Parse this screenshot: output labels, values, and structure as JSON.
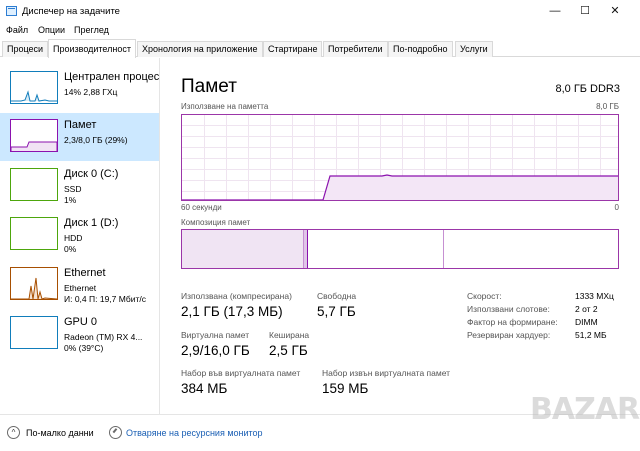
{
  "window": {
    "title": "Диспечер на задачите",
    "min_glyph": "—",
    "max_glyph": "☐",
    "close_glyph": "✕"
  },
  "menu": [
    "Файл",
    "Опции",
    "Преглед"
  ],
  "tabs": [
    {
      "label": "Процеси",
      "active": false
    },
    {
      "label": "Производителност",
      "active": true
    },
    {
      "label": "Хронология на приложение",
      "active": false
    },
    {
      "label": "Стартиране",
      "active": false
    },
    {
      "label": "Потребители",
      "active": false
    },
    {
      "label": "По-подробно",
      "active": false
    },
    {
      "label": "Услуги",
      "active": false
    }
  ],
  "sidebar": {
    "items": [
      {
        "name": "Централен процесор",
        "line1": "14%  2,88 ГХц",
        "line2": ""
      },
      {
        "name": "Памет",
        "line1": "2,3/8,0 ГБ (29%)",
        "line2": ""
      },
      {
        "name": "Диск 0 (C:)",
        "line1": "SSD",
        "line2": "1%"
      },
      {
        "name": "Диск 1 (D:)",
        "line1": "HDD",
        "line2": "0%"
      },
      {
        "name": "Ethernet",
        "line1": "Ethernet",
        "line2": "И: 0,4  П: 19,7 Мбит/с"
      },
      {
        "name": "GPU 0",
        "line1": "Radeon (TM) RX 4...",
        "line2": "0% (39°C)"
      }
    ]
  },
  "main": {
    "title": "Памет",
    "mem_type": "8,0 ГБ DDR3",
    "usage_label": "Използване на паметта",
    "usage_max": "8,0 ГБ",
    "time_left": "60 секунди",
    "time_right": "0",
    "composition_label": "Композиция памет",
    "stats": {
      "in_use_label": "Използвана (компресирана)",
      "in_use_value": "2,1 ГБ (17,3 МБ)",
      "available_label": "Свободна",
      "available_value": "5,7 ГБ",
      "committed_label": "Виртуална памет",
      "committed_value": "2,9/16,0 ГБ",
      "cached_label": "Кеширана",
      "cached_value": "2,5 ГБ",
      "paged_label": "Набор във виртуалната памет",
      "paged_value": "384 МБ",
      "nonpaged_label": "Набор извън виртуалната памет",
      "nonpaged_value": "159 МБ"
    },
    "details": [
      {
        "key": "Скорост:",
        "value": "1333 MXц"
      },
      {
        "key": "Използвани слотове:",
        "value": "2 от 2"
      },
      {
        "key": "Фактор на формиране:",
        "value": "DIMM"
      },
      {
        "key": "Резервиран хардуер:",
        "value": "51,2 МБ"
      }
    ]
  },
  "footer": {
    "fewer_details": "По-малко данни",
    "resource_monitor": "Отваряне на ресурсния монитор"
  },
  "watermark": "BAZAR",
  "colors": {
    "cpu": "#117dbb",
    "memory": "#8b12ae",
    "disk": "#4da60c",
    "ethernet": "#a74f01",
    "gpu": "#117dbb",
    "selected": "#cce8ff",
    "link": "#1a5fb4"
  }
}
